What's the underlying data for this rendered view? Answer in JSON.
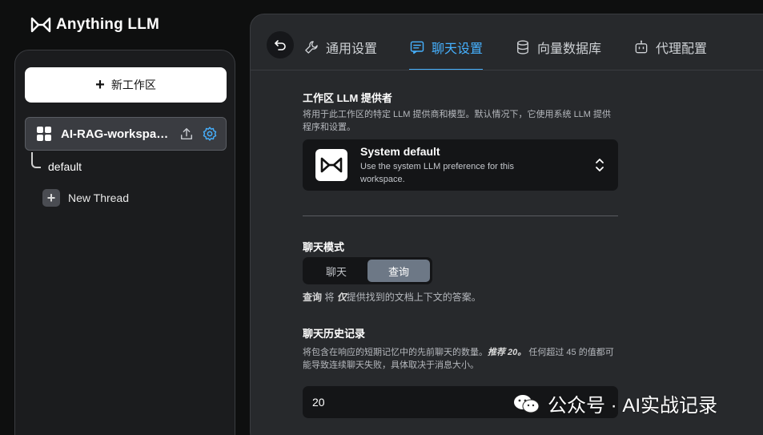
{
  "brand": {
    "name": "Anything LLM"
  },
  "sidebar": {
    "new_workspace_label": "新工作区",
    "workspace_name": "AI-RAG-workspac…",
    "threads": [
      {
        "label": "default"
      }
    ],
    "new_thread_label": "New Thread"
  },
  "tabs": [
    {
      "label": "通用设置",
      "icon": "wrench-icon",
      "active": false
    },
    {
      "label": "聊天设置",
      "icon": "chat-icon",
      "active": true
    },
    {
      "label": "向量数据库",
      "icon": "database-icon",
      "active": false
    },
    {
      "label": "代理配置",
      "icon": "robot-icon",
      "active": false
    }
  ],
  "llm_provider": {
    "title": "工作区 LLM 提供者",
    "description": "将用于此工作区的特定 LLM 提供商和模型。默认情况下，它使用系统 LLM 提供程序和设置。",
    "selected_title": "System default",
    "selected_sub": "Use the system LLM preference for this workspace."
  },
  "chat_mode": {
    "title": "聊天模式",
    "options": [
      "聊天",
      "查询"
    ],
    "selected": "查询",
    "desc_prefix": "查询",
    "desc_mid": " 将 ",
    "desc_em": "仅",
    "desc_suffix": "提供找到的文档上下文的答案。"
  },
  "chat_history": {
    "title": "聊天历史记录",
    "desc_part1": "将包含在响应的短期记忆中的先前聊天的数量。",
    "desc_em": "推荐 20。",
    "desc_part2": " 任何超过 45 的值都可能导致连续聊天失败，具体取决于消息大小。",
    "value": "20"
  },
  "watermark": {
    "text": "公众号 · AI实战记录"
  },
  "colors": {
    "accent": "#46b1ff",
    "toggle_on": "#6d7886",
    "panel": "#27292c",
    "sidebar": "#1b1c1e"
  }
}
